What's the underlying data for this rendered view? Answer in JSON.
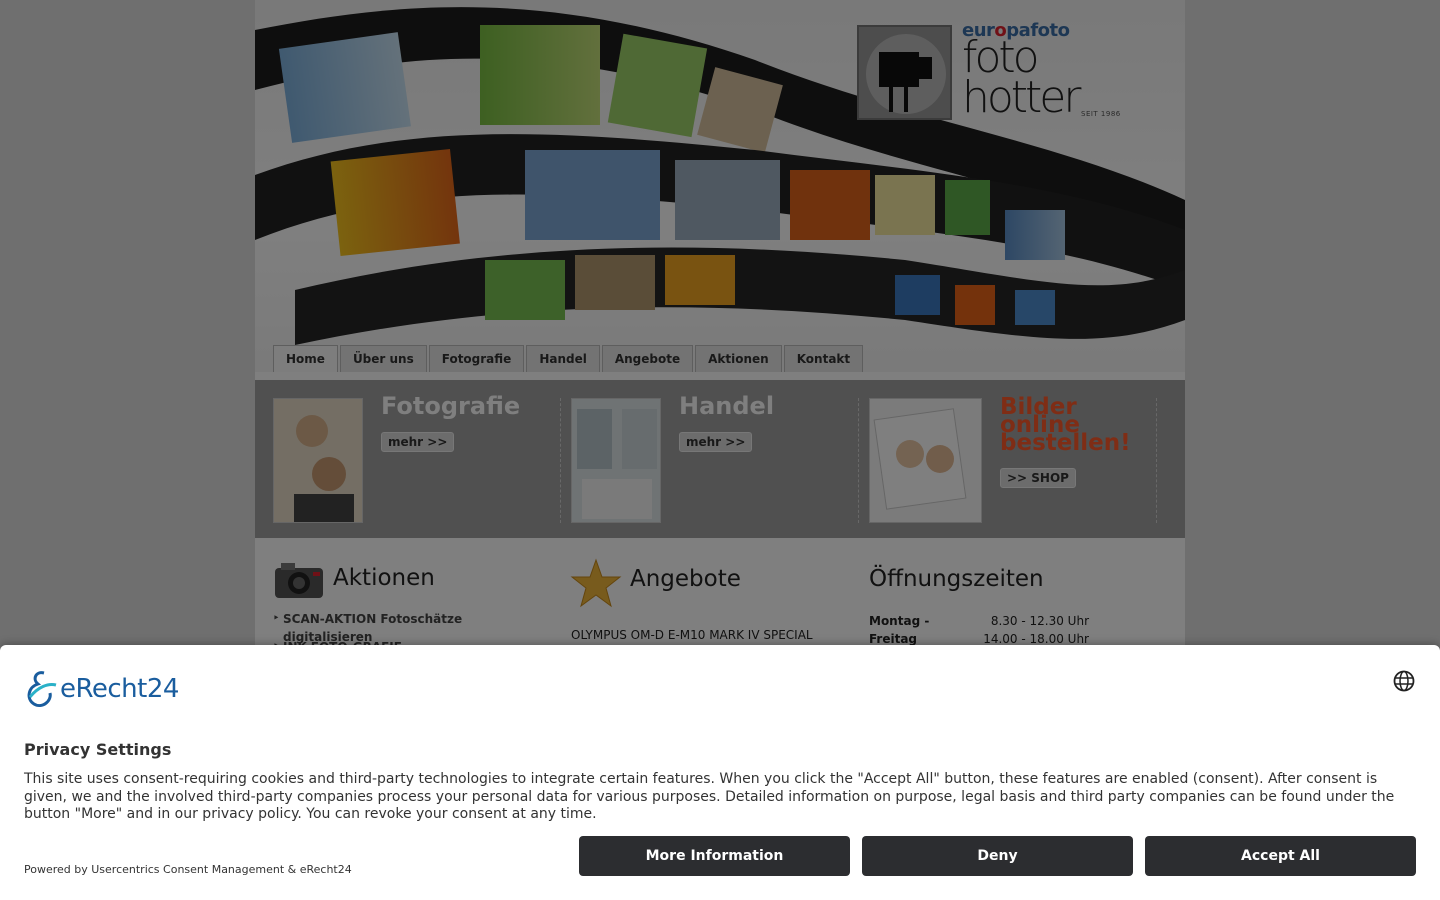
{
  "site": {
    "logo": {
      "brand_pre": "eur",
      "brand_dot": "o",
      "brand_post": "pafoto",
      "name_line1": "foto",
      "name_line2": "hotter",
      "since": "SEIT 1986"
    },
    "nav": {
      "items": [
        "Home",
        "Über uns",
        "Fotografie",
        "Handel",
        "Angebote",
        "Aktionen",
        "Kontakt"
      ],
      "active": "Home"
    },
    "teasers": [
      {
        "title": "Fotografie",
        "button": "mehr >>"
      },
      {
        "title": "Handel",
        "button": "mehr >>"
      },
      {
        "title": "Bilder online bestellen!",
        "button": ">> SHOP"
      }
    ],
    "aktionen": {
      "heading": "Aktionen",
      "items": [
        "SCAN-AKTION Fotoschätze digitalisieren",
        "INK-FOTO-GRAFIE"
      ]
    },
    "angebote": {
      "heading": "Angebote",
      "text": "OLYMPUS OM-D E-M10 MARK IV SPECIAL"
    },
    "oeffnungszeiten": {
      "heading": "Öffnungszeiten",
      "day_line1": "Montag -",
      "day_line2": "Freitag",
      "time_line1": "8.30 - 12.30 Uhr",
      "time_line2": "14.00 - 18.00 Uhr"
    },
    "colors": {
      "accent_red": "#ff5a2a",
      "brand_blue": "#3a6fa8"
    }
  },
  "consent": {
    "logo_text": "eRecht24",
    "title": "Privacy Settings",
    "body": "This site uses consent-requiring cookies and third-party technologies to integrate certain features. When you click the \"Accept All\" button, these features are enabled (consent). After consent is given, we and the involved third-party companies process your personal data for various purposes. Detailed information on purpose, legal basis and third party companies can be found under the button \"More\" and in our privacy policy. You can revoke your consent at any time.",
    "powered": "Powered by Usercentrics Consent Management & eRecht24",
    "buttons": {
      "more": "More Information",
      "deny": "Deny",
      "accept": "Accept All"
    },
    "language_icon": "globe-icon",
    "colors": {
      "button_bg": "#2c2d30",
      "logo_blue": "#1a5d9e"
    }
  }
}
